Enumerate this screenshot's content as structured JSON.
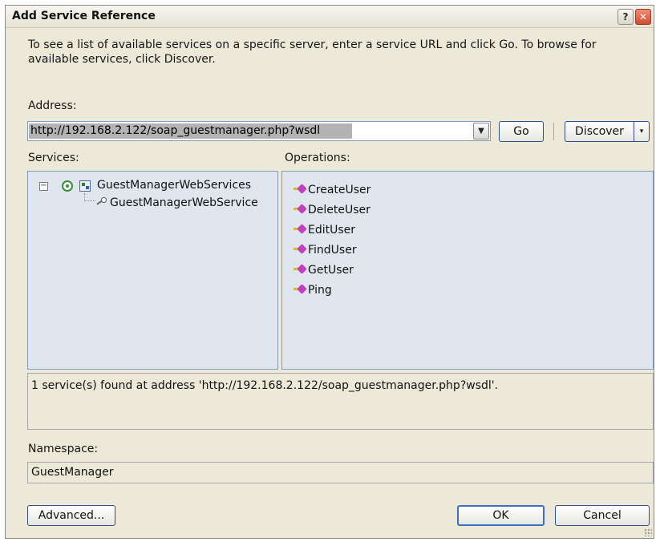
{
  "dialog": {
    "title": "Add Service Reference",
    "help_button": "?",
    "close_button": "✕"
  },
  "instructions": "To see a list of available services on a specific server, enter a service URL and click Go. To browse for available services, click Discover.",
  "address": {
    "label": "Address:",
    "value": "http://192.168.2.122/soap_guestmanager.php?wsdl",
    "dropdown_icon": "chevron-down-icon"
  },
  "buttons": {
    "go": "Go",
    "discover": "Discover",
    "discover_dropdown": "▾",
    "advanced": "Advanced...",
    "ok": "OK",
    "cancel": "Cancel"
  },
  "services": {
    "label": "Services:",
    "tree": {
      "root": "GuestManagerWebServices",
      "expanded": true,
      "children": [
        "GuestManagerWebService"
      ]
    }
  },
  "operations": {
    "label": "Operations:",
    "items": [
      "CreateUser",
      "DeleteUser",
      "EditUser",
      "FindUser",
      "GetUser",
      "Ping"
    ]
  },
  "status": "1 service(s) found at address 'http://192.168.2.122/soap_guestmanager.php?wsdl'.",
  "namespace": {
    "label": "Namespace:",
    "value": "GuestManager"
  }
}
